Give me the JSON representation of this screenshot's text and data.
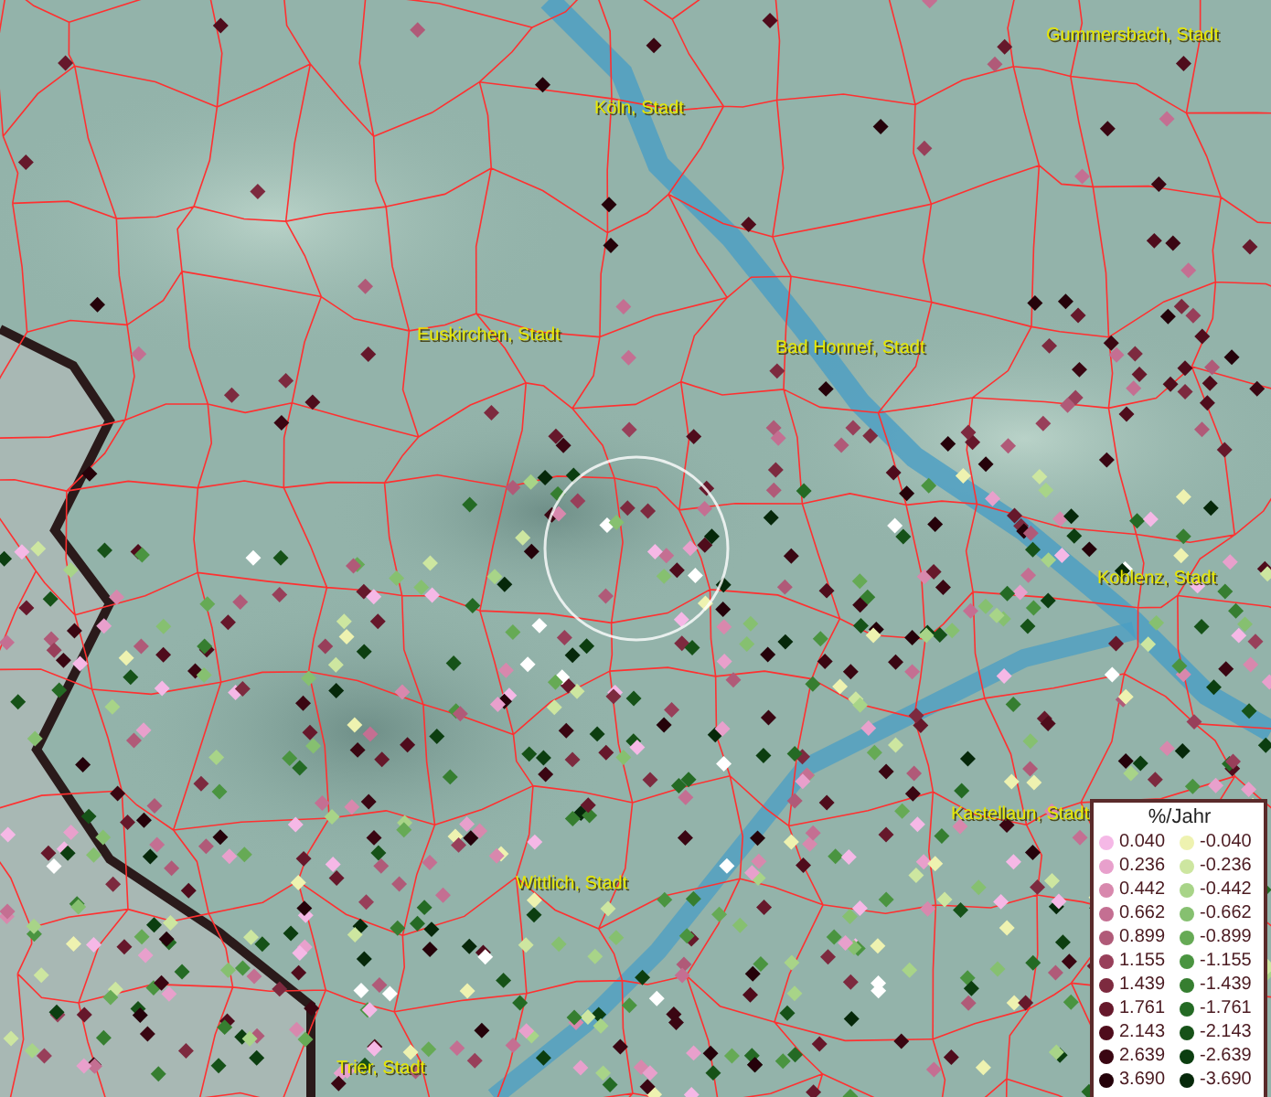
{
  "map": {
    "places": [
      {
        "name": "Gummersbach, Stadt"
      },
      {
        "name": "Köln, Stadt"
      },
      {
        "name": "Euskirchen, Stadt"
      },
      {
        "name": "Bad Honnef, Stadt"
      },
      {
        "name": "Koblenz, Stadt"
      },
      {
        "name": "Kastellaun, Stadt"
      },
      {
        "name": "Wittlich, Stadt"
      },
      {
        "name": "Trier, Stadt"
      }
    ]
  },
  "legend": {
    "title": "%/Jahr",
    "positive": [
      {
        "label": "0.040",
        "color": "#f5b8e6"
      },
      {
        "label": "0.236",
        "color": "#e8a0cc"
      },
      {
        "label": "0.442",
        "color": "#d888ad"
      },
      {
        "label": "0.662",
        "color": "#c46f92"
      },
      {
        "label": "0.899",
        "color": "#b05a78"
      },
      {
        "label": "1.155",
        "color": "#983f5a"
      },
      {
        "label": "1.439",
        "color": "#7d2a3f"
      },
      {
        "label": "1.761",
        "color": "#66182b"
      },
      {
        "label": "2.143",
        "color": "#4f0c1c"
      },
      {
        "label": "2.639",
        "color": "#3a0612"
      },
      {
        "label": "3.690",
        "color": "#25020a"
      }
    ],
    "negative": [
      {
        "label": "-0.040",
        "color": "#eef2b0"
      },
      {
        "label": "-0.236",
        "color": "#cde6a0"
      },
      {
        "label": "-0.442",
        "color": "#a8d488"
      },
      {
        "label": "-0.662",
        "color": "#86c070"
      },
      {
        "label": "-0.899",
        "color": "#66aa55"
      },
      {
        "label": "-1.155",
        "color": "#4a9440"
      },
      {
        "label": "-1.439",
        "color": "#367e30"
      },
      {
        "label": "-1.761",
        "color": "#246a24"
      },
      {
        "label": "-2.143",
        "color": "#165218"
      },
      {
        "label": "-2.639",
        "color": "#0c3e10"
      },
      {
        "label": "-3.690",
        "color": "#06280a"
      }
    ]
  }
}
